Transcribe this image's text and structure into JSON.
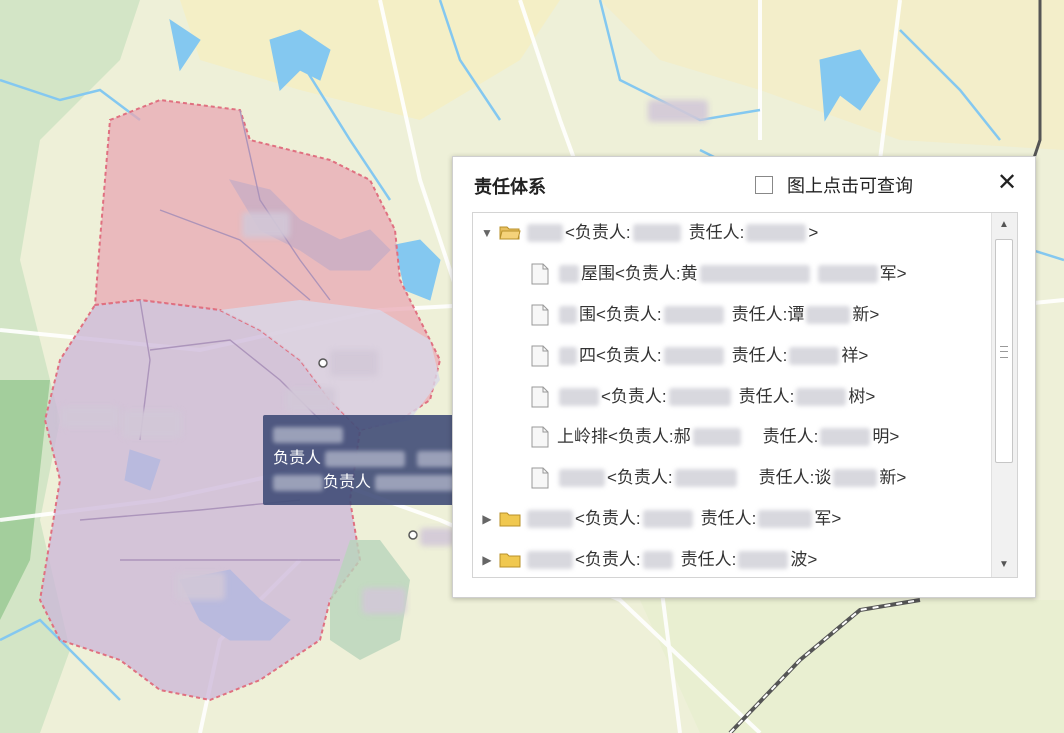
{
  "panel": {
    "title": "责任体系",
    "map_query_label": "图上点击可查询",
    "close_label": "✕"
  },
  "tooltip": {
    "line2_label": "负责人",
    "line3_label": "负责人",
    "line3_end": ">"
  },
  "tree": {
    "toggle_expanded": "▼",
    "toggle_collapsed": "▶",
    "label_owner": "<负责人:",
    "label_resp": "责任人:",
    "close_bracket": ">",
    "rows": [
      {
        "type": "folder",
        "expanded": true,
        "pre": "",
        "text": "<负责人:",
        "mid": "责任人:",
        "end": ">"
      },
      {
        "type": "file",
        "pre": "",
        "name_tail": "屋围",
        "text": "<负责人:黄",
        "mid": "",
        "end": "军>"
      },
      {
        "type": "file",
        "pre": "",
        "name_tail": "围",
        "text": "<负责人:",
        "mid": "责任人:谭",
        "end": "新>"
      },
      {
        "type": "file",
        "pre": "",
        "name_tail": "四",
        "text": "<负责人:",
        "mid": "责任人:",
        "end": "祥>"
      },
      {
        "type": "file",
        "pre": "",
        "name_tail": "",
        "text": "<负责人:",
        "mid": "责任人:",
        "end": "树>"
      },
      {
        "type": "file",
        "pre": "",
        "name_tail": "上岭排",
        "text": "<负责人:郝",
        "mid": "责任人:",
        "end": "明>"
      },
      {
        "type": "file",
        "pre": "",
        "name_tail": "",
        "text": "<负责人:",
        "mid": "责任人:谈",
        "end": "新>"
      },
      {
        "type": "folder",
        "expanded": false,
        "pre": "",
        "text": "<负责人:",
        "mid": "责任人:",
        "end": "军>"
      },
      {
        "type": "folder",
        "expanded": false,
        "pre": "",
        "text": "<负责人:",
        "mid": "责任人:",
        "end": "波>"
      }
    ]
  },
  "colors": {
    "map_bg": "#e9ecd6",
    "water": "#84c8f0",
    "district_red": "#e8a8b0",
    "district_purple": "#c8b4d8",
    "tooltip_bg": "#404c78"
  }
}
